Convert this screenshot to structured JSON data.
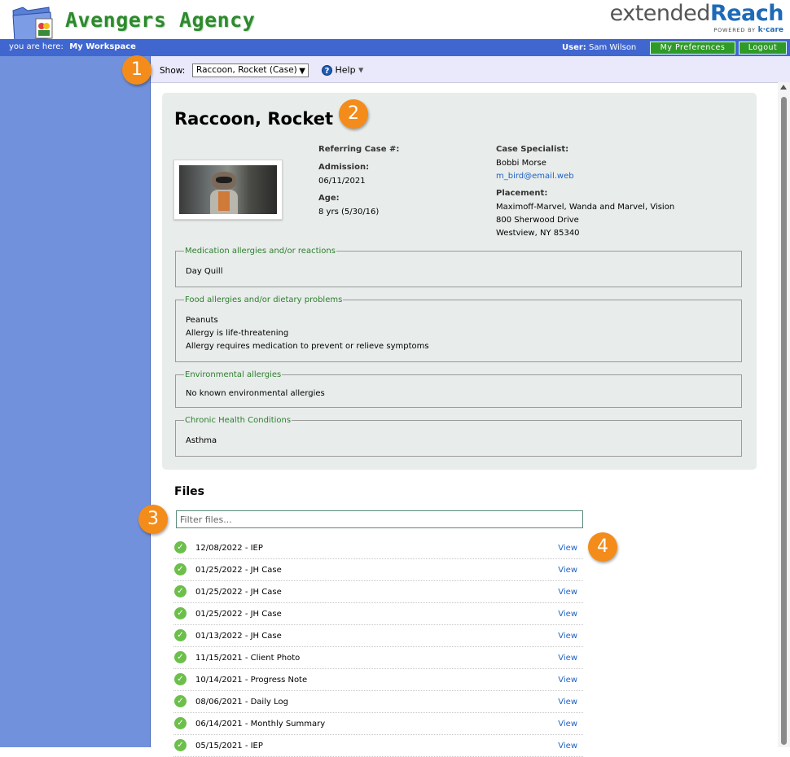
{
  "header": {
    "agency_name": "Avengers Agency",
    "brand_part1": "extended",
    "brand_part2": "Reach",
    "brand_powered": "POWERED BY",
    "brand_kcare": "k·care"
  },
  "navbar": {
    "crumb_label": "you are here:",
    "crumb_value": "My Workspace",
    "user_label": "User:",
    "user_name": "Sam Wilson",
    "preferences_label": "My Preferences",
    "logout_label": "Logout"
  },
  "toolbar": {
    "show_label": "Show:",
    "show_selected": "Raccoon, Rocket (Case)",
    "help_label": "Help"
  },
  "case": {
    "name": "Raccoon, Rocket",
    "referring_label": "Referring Case #:",
    "admission_label": "Admission:",
    "admission_value": "06/11/2021",
    "age_label": "Age:",
    "age_value": "8 yrs (5/30/16)",
    "specialist_label": "Case Specialist:",
    "specialist_name": "Bobbi Morse",
    "specialist_email": "m_bird@email.web",
    "placement_label": "Placement:",
    "placement_line1": "Maximoff-Marvel, Wanda and Marvel, Vision",
    "placement_line2": "800 Sherwood Drive",
    "placement_line3": "Westview, NY 85340"
  },
  "allergies": {
    "medication": {
      "legend": "Medication allergies and/or reactions",
      "lines": [
        "Day Quill"
      ]
    },
    "food": {
      "legend": "Food allergies and/or dietary problems",
      "lines": [
        "Peanuts",
        "Allergy is life-threatening",
        "Allergy requires medication to prevent or relieve symptoms"
      ]
    },
    "environmental": {
      "legend": "Environmental allergies",
      "lines": [
        "No known environmental allergies"
      ]
    },
    "chronic": {
      "legend": "Chronic Health Conditions",
      "lines": [
        "Asthma"
      ]
    }
  },
  "files": {
    "title": "Files",
    "filter_placeholder": "Filter files...",
    "view_label": "View",
    "items": [
      "12/08/2022 - IEP",
      "01/25/2022 - JH Case",
      "01/25/2022 - JH Case",
      "01/25/2022 - JH Case",
      "01/13/2022 - JH Case",
      "11/15/2021 - Client Photo",
      "10/14/2021 - Progress Note",
      "08/06/2021 - Daily Log",
      "06/14/2021 - Monthly Summary",
      "05/15/2021 - IEP"
    ]
  },
  "callouts": [
    "1",
    "2",
    "3",
    "4"
  ],
  "colors": {
    "nav_blue": "#4066cf",
    "sidebar_blue": "#7191dd",
    "agency_green": "#2d8a2d",
    "callout_orange": "#f38c1a",
    "check_green": "#6cc04a",
    "link_blue": "#1e62c4"
  }
}
